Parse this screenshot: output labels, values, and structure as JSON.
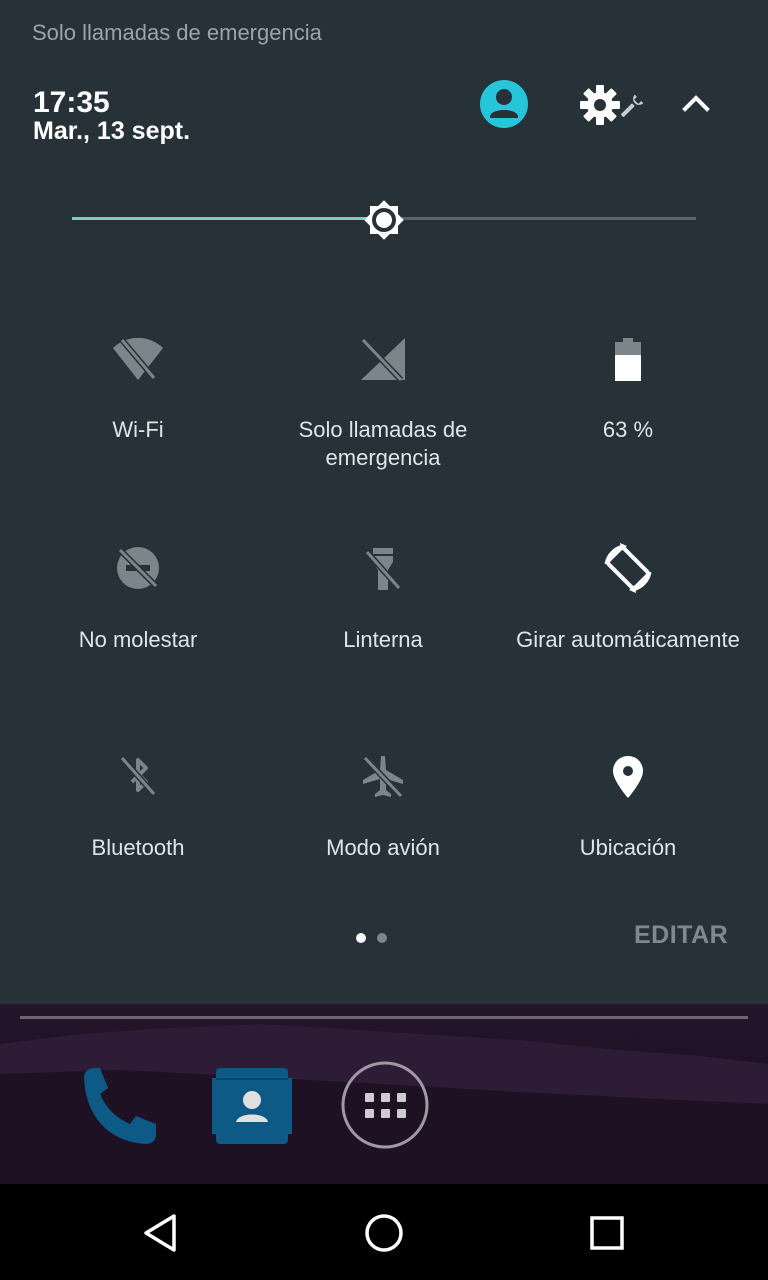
{
  "status_bar": {
    "text": "Solo llamadas de emergencia"
  },
  "header": {
    "time": "17:35",
    "date": "Mar., 13 sept.",
    "icons": [
      "account-icon",
      "settings-gear-icon",
      "wrench-icon",
      "chevron-up-icon"
    ],
    "accent": "#26c6da"
  },
  "brightness": {
    "level": 0.5,
    "accent": "#80cbc4"
  },
  "tiles": [
    {
      "label": "Wi-Fi",
      "icon": "wifi-off-icon",
      "state": "off"
    },
    {
      "label": "Solo llamadas de emergencia",
      "icon": "signal-off-icon",
      "state": "off"
    },
    {
      "label": "63 %",
      "icon": "battery-icon",
      "state": "on"
    },
    {
      "label": "No molestar",
      "icon": "do-not-disturb-off-icon",
      "state": "off"
    },
    {
      "label": "Linterna",
      "icon": "flashlight-off-icon",
      "state": "off"
    },
    {
      "label": "Girar automáticamente",
      "icon": "rotate-icon",
      "state": "on"
    },
    {
      "label": "Bluetooth",
      "icon": "bluetooth-off-icon",
      "state": "off"
    },
    {
      "label": "Modo avión",
      "icon": "airplane-off-icon",
      "state": "off"
    },
    {
      "label": "Ubicación",
      "icon": "location-icon",
      "state": "on"
    }
  ],
  "pager": {
    "pages": 2,
    "current": 1
  },
  "edit_label": "EDITAR",
  "dock": {
    "icons": [
      "phone-icon",
      "contacts-icon",
      "app-drawer-icon"
    ]
  },
  "navigation": {
    "icons": [
      "back-icon",
      "home-icon",
      "recents-icon"
    ]
  }
}
